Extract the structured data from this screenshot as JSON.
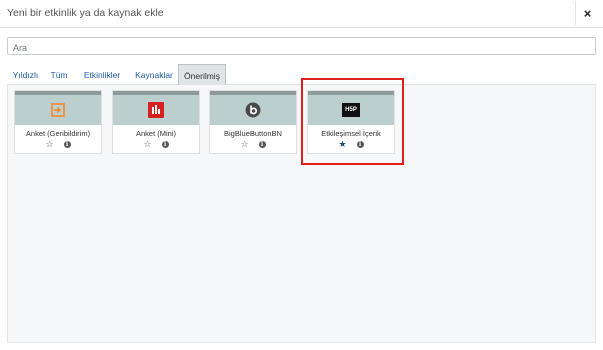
{
  "modal": {
    "title": "Yeni bir etkinlik ya da kaynak ekle",
    "close_label": "×"
  },
  "search": {
    "placeholder": "Ara",
    "value": ""
  },
  "tabs": [
    {
      "label": "Yıldızlı",
      "active": false
    },
    {
      "label": "Tüm",
      "active": false
    },
    {
      "label": "Etkinlikler",
      "active": false
    },
    {
      "label": "Kaynaklar",
      "active": false
    },
    {
      "label": "Önerilmiş",
      "active": true
    }
  ],
  "cards": [
    {
      "label": "Anket (Geribildirim)",
      "icon": "feedback-arrow-icon",
      "icon_color": "#f0903e",
      "starred": false
    },
    {
      "label": "Anket (Mini)",
      "icon": "bar-chart-icon",
      "icon_color": "#d5201f",
      "starred": false
    },
    {
      "label": "BigBlueButtonBN",
      "icon": "bigbluebutton-icon",
      "icon_color": "#4a4a4a",
      "starred": false
    },
    {
      "label": "Etkileşimsel İçerik",
      "icon": "h5p-icon",
      "icon_text": "H5P",
      "icon_color": "#111111",
      "starred": true
    }
  ],
  "colors": {
    "highlight": "#e0201a",
    "card_header": "#bccfcf",
    "link": "#1d5ea8"
  }
}
